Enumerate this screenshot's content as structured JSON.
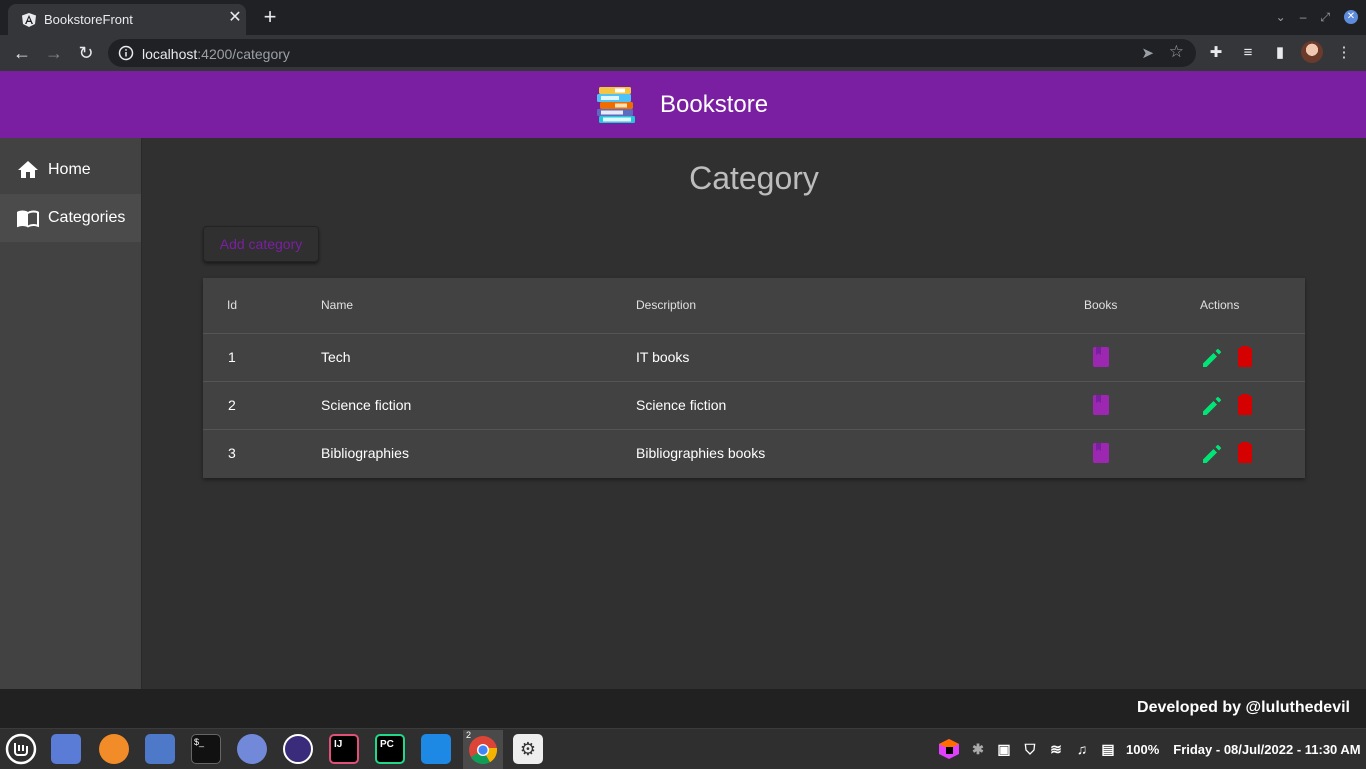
{
  "browser": {
    "tab_title": "BookstoreFront",
    "url_host": "localhost",
    "url_path": ":4200/category"
  },
  "app": {
    "title": "Bookstore",
    "page_title": "Category",
    "add_button": "Add category",
    "footer": "Developed by @luluthedevil"
  },
  "sidebar": {
    "items": [
      {
        "label": "Home",
        "icon": "home-icon"
      },
      {
        "label": "Categories",
        "icon": "menu-book-icon"
      }
    ]
  },
  "table": {
    "headers": [
      "Id",
      "Name",
      "Description",
      "Books",
      "Actions"
    ],
    "rows": [
      {
        "id": "1",
        "name": "Tech",
        "description": "IT books"
      },
      {
        "id": "2",
        "name": "Science fiction",
        "description": "Science fiction"
      },
      {
        "id": "3",
        "name": "Bibliographies",
        "description": "Bibliographies books"
      }
    ]
  },
  "taskbar": {
    "terminal_badge": "$_",
    "intellij_label": "IJ",
    "pycharm_label": "PC",
    "chrome_badge": "2",
    "battery": "100%",
    "clock": "Friday - 08/Jul/2022 - 11:30 AM"
  },
  "colors": {
    "header": "#7b1fa2",
    "accent": "#7b1fa2",
    "book_icon": "#9c27b0",
    "edit_icon": "#00e676",
    "delete_icon": "#d50000"
  }
}
